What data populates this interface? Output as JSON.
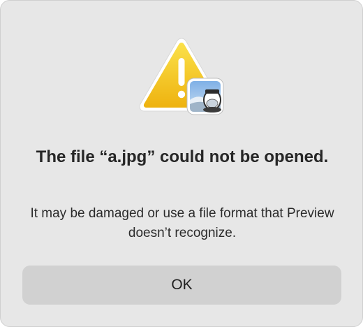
{
  "dialog": {
    "title": "The file “a.jpg” could not be opened.",
    "message": "It may be damaged or use a file format that Preview doesn’t recognize.",
    "ok_label": "OK"
  },
  "icons": {
    "main": "warning-triangle-icon",
    "badge": "preview-app-icon"
  },
  "colors": {
    "dialog_background": "#e7e7e7",
    "button_background": "#d1d1d1",
    "warning_yellow": "#f4c415",
    "text": "#262626"
  }
}
